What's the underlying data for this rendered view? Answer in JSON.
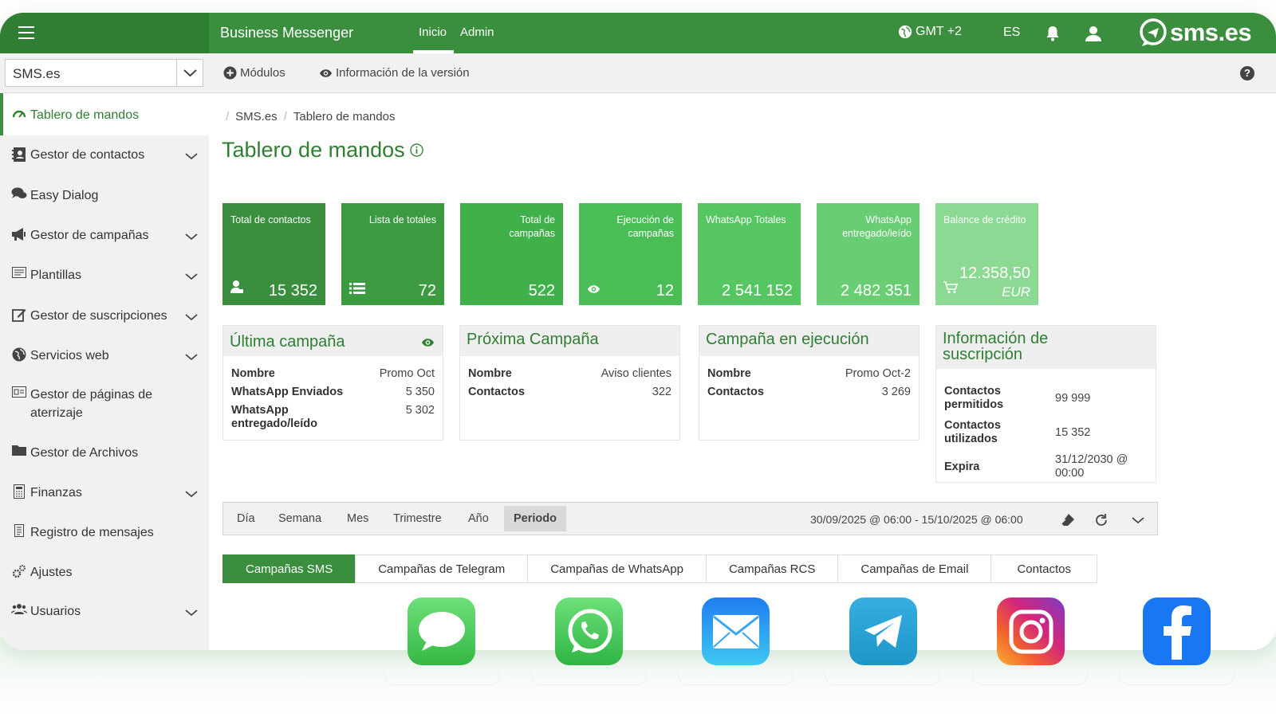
{
  "topbar": {
    "app_title": "Business Messenger",
    "nav": [
      "Inicio",
      "Admin"
    ],
    "timezone": "GMT +2",
    "language": "ES",
    "logo_text": "sms.es"
  },
  "subbar": {
    "company": "SMS.es",
    "modules": "Módulos",
    "version_info": "Información de la versión",
    "help": "?"
  },
  "sidebar": {
    "items": [
      {
        "label": "Tablero de mandos",
        "icon": "dashboard-icon"
      },
      {
        "label": "Gestor de contactos",
        "icon": "contacts-icon"
      },
      {
        "label": "Easy Dialog",
        "icon": "chat-icon"
      },
      {
        "label": "Gestor de campañas",
        "icon": "megaphone-icon"
      },
      {
        "label": "Plantillas",
        "icon": "templates-icon"
      },
      {
        "label": "Gestor de suscripciones",
        "icon": "edit-icon"
      },
      {
        "label": "Servicios web",
        "icon": "globe-icon"
      },
      {
        "label": "Gestor de páginas de aterrizaje",
        "icon": "landing-icon"
      },
      {
        "label": "Gestor de Archivos",
        "icon": "folder-icon"
      },
      {
        "label": "Finanzas",
        "icon": "finance-icon"
      },
      {
        "label": "Registro de mensajes",
        "icon": "log-icon"
      },
      {
        "label": "Ajustes",
        "icon": "gears-icon"
      },
      {
        "label": "Usuarios",
        "icon": "users-icon"
      }
    ]
  },
  "breadcrumb": [
    "SMS.es",
    "Tablero de mandos"
  ],
  "page_title": "Tablero de mandos",
  "tiles": [
    {
      "label": "Total de contactos",
      "value": "15 352",
      "color": "#3a8e3e"
    },
    {
      "label": "Lista de totales",
      "value": "72",
      "color": "#3c9a40"
    },
    {
      "label": "Total de campañas",
      "value": "522",
      "color": "#40b04a"
    },
    {
      "label": "Ejecución de campañas",
      "value": "12",
      "color": "#4bbd56"
    },
    {
      "label": "WhatsApp Totales",
      "value": "2 541 152",
      "color": "#56c662"
    },
    {
      "label": "WhatsApp entregado/leído",
      "value": "2 482 351",
      "color": "#68cd73"
    },
    {
      "label": "Balance de crédito",
      "value": "12.358,50",
      "unit": "EUR",
      "color": "#8bd993"
    }
  ],
  "cards": {
    "last_campaign": {
      "title": "Última campaña",
      "rows": [
        {
          "k": "Nombre",
          "v": "Promo Oct"
        },
        {
          "k": "WhatsApp Enviados",
          "v": "5 350"
        },
        {
          "k": "WhatsApp entregado/leído",
          "v": "5 302"
        }
      ]
    },
    "next_campaign": {
      "title": "Próxima Campaña",
      "rows": [
        {
          "k": "Nombre",
          "v": "Aviso clientes"
        },
        {
          "k": "Contactos",
          "v": "322"
        }
      ]
    },
    "running_campaign": {
      "title": "Campaña en ejecución",
      "rows": [
        {
          "k": "Nombre",
          "v": "Promo Oct-2"
        },
        {
          "k": "Contactos",
          "v": "3 269"
        }
      ]
    },
    "subscription": {
      "title": "Información de suscripción",
      "rows": [
        {
          "k": "Contactos permitidos",
          "v": "99 999"
        },
        {
          "k": "Contactos utilizados",
          "v": "15 352"
        },
        {
          "k": "Expira",
          "v": "31/12/2030 @ 00:00"
        }
      ]
    }
  },
  "period": {
    "buttons": [
      "Día",
      "Semana",
      "Mes",
      "Trimestre",
      "Año",
      "Periodo"
    ],
    "active": "Periodo",
    "range": "30/09/2025 @ 06:00 - 15/10/2025 @ 06:00"
  },
  "tabs": [
    "Campañas SMS",
    "Campañas de Telegram",
    "Campañas de WhatsApp",
    "Campañas RCS",
    "Campañas de Email",
    "Contactos"
  ],
  "channel_icons": [
    "sms-icon",
    "whatsapp-icon",
    "email-icon",
    "telegram-icon",
    "instagram-icon",
    "facebook-icon"
  ],
  "colors": {
    "brand": "#3a8e3e",
    "brand_dark": "#2f7e33",
    "title_green": "#2f7e33"
  }
}
